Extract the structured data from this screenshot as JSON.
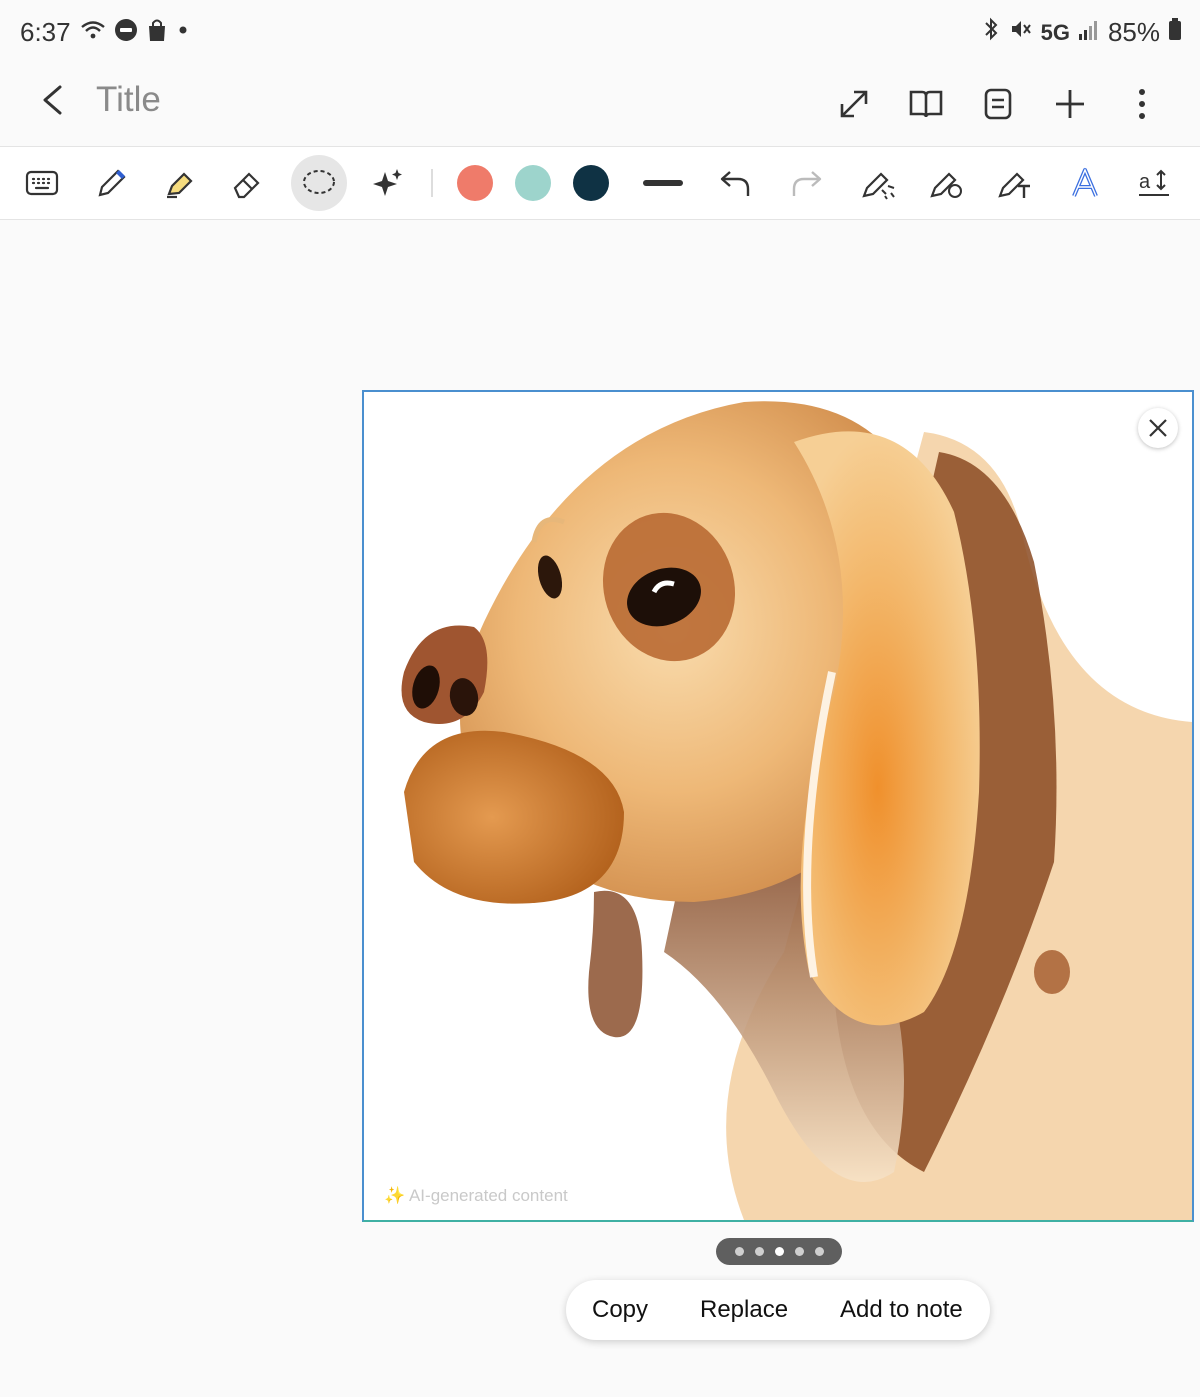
{
  "status_bar": {
    "time": "6:37",
    "network": "5G",
    "battery": "85%",
    "icons": [
      "wifi-icon",
      "wear-icon",
      "bag-icon",
      "dot-icon",
      "bluetooth-icon",
      "mute-icon",
      "signal-icon",
      "battery-icon"
    ]
  },
  "app_bar": {
    "title": "Title",
    "back_icon": "back-arrow-icon",
    "actions": [
      "expand-icon",
      "book-icon",
      "page-icon",
      "add-icon",
      "more-vert-icon"
    ]
  },
  "toolbar": {
    "tools": [
      "keyboard-icon",
      "pen-icon",
      "highlighter-icon",
      "eraser-icon",
      "lasso-icon",
      "ai-sparkle-icon"
    ],
    "active_tool": "lasso-icon",
    "colors": [
      "#ef7b6a",
      "#9dd4cc",
      "#0f3244"
    ],
    "more_tools": [
      "line-width-icon",
      "undo-icon",
      "redo-icon",
      "shape-pen-icon",
      "style-pen-icon",
      "text-pen-icon",
      "font-a-icon",
      "text-size-icon"
    ]
  },
  "generated_image": {
    "watermark": "AI-generated content",
    "close_icon": "close-icon"
  },
  "pager": {
    "count": 5,
    "active_index": 2
  },
  "image_actions": {
    "copy": "Copy",
    "replace": "Replace",
    "add_to_note": "Add to note"
  }
}
